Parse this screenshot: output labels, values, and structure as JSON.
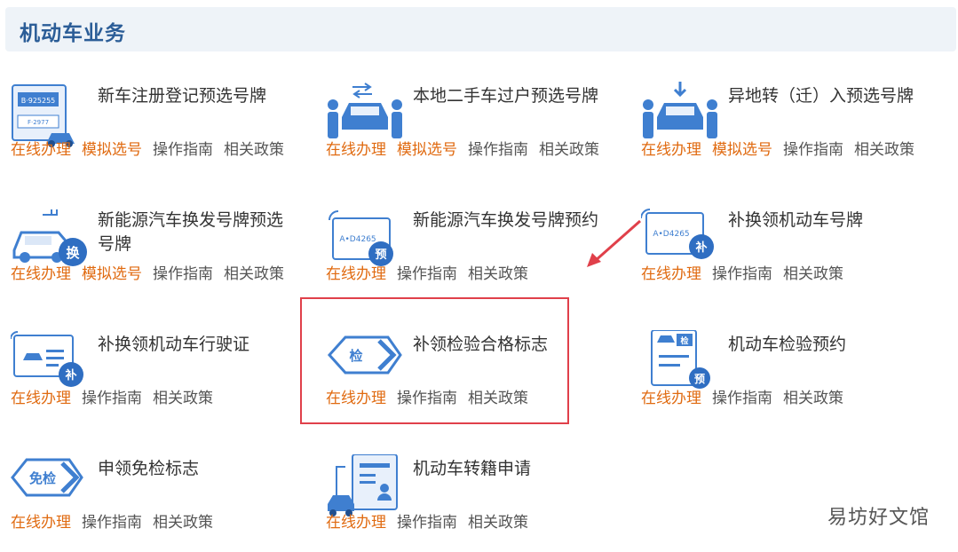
{
  "header": {
    "title": "机动车业务"
  },
  "cards": [
    {
      "title": "新车注册登记预选号牌",
      "links": [
        "在线办理",
        "模拟选号",
        "操作指南",
        "相关政策"
      ],
      "icon": "new-car-plate-icon"
    },
    {
      "title": "本地二手车过户预选号牌",
      "links": [
        "在线办理",
        "模拟选号",
        "操作指南",
        "相关政策"
      ],
      "icon": "used-car-transfer-icon"
    },
    {
      "title": "异地转（迁）入预选号牌",
      "links": [
        "在线办理",
        "模拟选号",
        "操作指南",
        "相关政策"
      ],
      "icon": "transfer-in-icon"
    },
    {
      "title": "新能源汽车换发号牌预选号牌",
      "links": [
        "在线办理",
        "模拟选号",
        "操作指南",
        "相关政策"
      ],
      "icon": "ev-plate-select-icon",
      "badge": "换"
    },
    {
      "title": "新能源汽车换发号牌预约",
      "links": [
        "在线办理",
        "操作指南",
        "相关政策"
      ],
      "icon": "ev-plate-appointment-icon",
      "badge": "预",
      "plate": "A•D4265"
    },
    {
      "title": "补换领机动车号牌",
      "links": [
        "在线办理",
        "操作指南",
        "相关政策"
      ],
      "icon": "replace-plate-icon",
      "badge": "补",
      "plate": "A•D4265"
    },
    {
      "title": "补换领机动车行驶证",
      "links": [
        "在线办理",
        "操作指南",
        "相关政策"
      ],
      "icon": "replace-license-icon",
      "badge": "补"
    },
    {
      "title": "补领检验合格标志",
      "links": [
        "在线办理",
        "操作指南",
        "相关政策"
      ],
      "icon": "inspection-mark-icon",
      "badge": "检"
    },
    {
      "title": "机动车检验预约",
      "links": [
        "在线办理",
        "操作指南",
        "相关政策"
      ],
      "icon": "inspection-appointment-icon",
      "badge": "检",
      "badge2": "预"
    },
    {
      "title": "申领免检标志",
      "links": [
        "在线办理",
        "操作指南",
        "相关政策"
      ],
      "icon": "exempt-mark-icon",
      "badge": "免检"
    },
    {
      "title": "机动车转籍申请",
      "links": [
        "在线办理",
        "操作指南",
        "相关政策"
      ],
      "icon": "registration-transfer-icon"
    }
  ],
  "plate_texts": {
    "top": "B·925255",
    "bottom": "F·2977"
  },
  "watermark": "易坊好文馆",
  "colors": {
    "accent": "#e06a10",
    "header_text": "#2b5d97",
    "icon_blue": "#3f7fd0",
    "highlight": "#e0404a"
  }
}
